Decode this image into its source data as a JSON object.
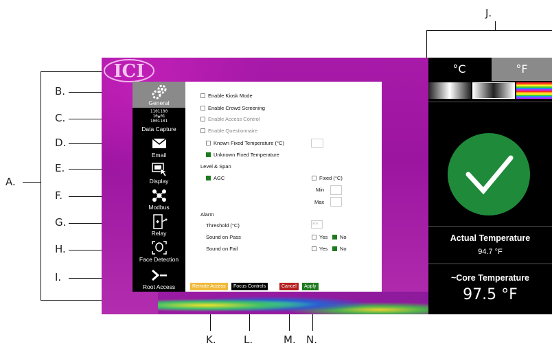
{
  "callouts": {
    "A": "A.",
    "B": "B.",
    "C": "C.",
    "D": "D.",
    "E": "E.",
    "F": "F.",
    "G": "G.",
    "H": "H.",
    "I": "I.",
    "J": "J.",
    "K": "K.",
    "L": "L.",
    "M": "M.",
    "N": "N."
  },
  "logo": "ICI",
  "sidebar": {
    "items": [
      {
        "label": "General",
        "icon": "gear-icon",
        "active": true
      },
      {
        "label": "Data Capture",
        "icon": "data-capture-icon",
        "active": false
      },
      {
        "label": "Email",
        "icon": "envelope-icon",
        "active": false
      },
      {
        "label": "Display",
        "icon": "display-icon",
        "active": false
      },
      {
        "label": "Modbus",
        "icon": "modbus-icon",
        "active": false
      },
      {
        "label": "Relay",
        "icon": "relay-icon",
        "active": false
      },
      {
        "label": "Face Detection",
        "icon": "face-icon",
        "active": false
      },
      {
        "label": "Root Access",
        "icon": "terminal-icon",
        "active": false
      }
    ],
    "data_capture_bits": [
      "1101100",
      "10",
      "01",
      "1001101"
    ]
  },
  "general": {
    "kiosk": "Enable Kiosk Mode",
    "crowd": "Enable Crowd Screening",
    "access": "Enable Access Control",
    "questionnaire": "Enable Questionnaire",
    "known_fixed": "Known Fixed Temperature (°C)",
    "unknown_fixed": "Unknown Fixed Temperature",
    "level_span": "Level & Span",
    "agc": "AGC",
    "fixed": "Fixed (°C)",
    "min": "Min",
    "max": "Max",
    "alarm": "Alarm",
    "threshold": "Threshold (°C)",
    "threshold_value": "37.5",
    "sound_pass": "Sound on Pass",
    "sound_fail": "Sound on Fail",
    "yes": "Yes",
    "no": "No"
  },
  "buttons": {
    "remote": "Remote Access",
    "focus": "Focus Controls",
    "cancel": "Cancel",
    "apply": "Apply"
  },
  "colors": {
    "remote": "#f0b93a",
    "focus": "#000000",
    "cancel": "#b41f1f",
    "apply": "#1e7a1e",
    "pass": "#1f8a3a",
    "active_tab": "#8a8a8a"
  },
  "right": {
    "unit_c": "°C",
    "unit_f": "°F",
    "actual_label": "Actual Temperature",
    "actual_value": "94.7 °F",
    "core_label": "~Core Temperature",
    "core_value": "97.5 °F",
    "status_icon": "checkmark-icon"
  }
}
